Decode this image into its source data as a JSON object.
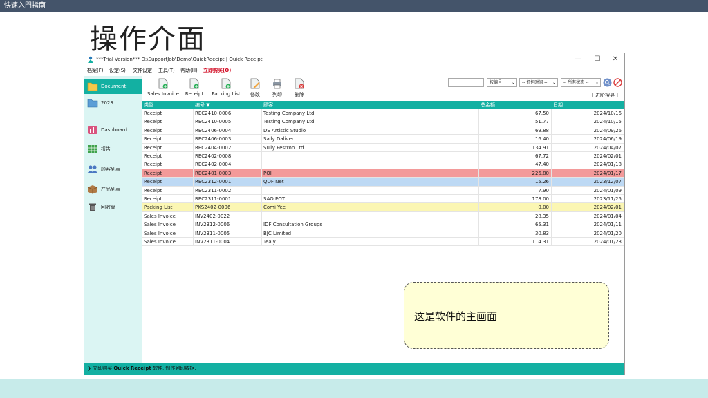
{
  "slide": {
    "header": "快速入門指南",
    "title": "操作介面"
  },
  "window": {
    "title": "***Trial Version*** D:\\SupportJob\\Demo\\QuickReceipt | Quick Receipt",
    "minimize": "—",
    "maximize": "☐",
    "close": "✕"
  },
  "menu": {
    "file": "档案(F)",
    "settings": "设定(S)",
    "doc_settings": "文件设定",
    "tools": "工具(T)",
    "help": "帮助(H)",
    "buy": "立即购买(O)"
  },
  "sidebar": {
    "items": [
      {
        "label": "Document"
      },
      {
        "label": "2023"
      },
      {
        "label": "Dashboard"
      },
      {
        "label": "报告"
      },
      {
        "label": "顾客列表"
      },
      {
        "label": "产品列表"
      },
      {
        "label": "回收筒"
      }
    ]
  },
  "toolbar": {
    "sales_invoice": "Sales Invoice",
    "receipt": "Receipt",
    "packing_list": "Packing List",
    "edit": "修改",
    "print": "列印",
    "delete": "删除",
    "filter_field": "按编号",
    "filter_time": "-- 任何时间 --",
    "filter_status": "-- 所有状态 --",
    "advanced": "[ 进阶搜寻 ]"
  },
  "table": {
    "headers": [
      "类型",
      "编号 ▼",
      "顾客",
      "总金额",
      "日期"
    ],
    "rows": [
      {
        "type": "Receipt",
        "no": "REC2410-0006",
        "customer": "Testing Company Ltd",
        "amount": "67.50",
        "date": "2024/10/16"
      },
      {
        "type": "Receipt",
        "no": "REC2410-0005",
        "customer": "Testing Company Ltd",
        "amount": "51.77",
        "date": "2024/10/15"
      },
      {
        "type": "Receipt",
        "no": "REC2406-0004",
        "customer": "DS Artistic Studio",
        "amount": "69.88",
        "date": "2024/09/26"
      },
      {
        "type": "Receipt",
        "no": "REC2406-0003",
        "customer": "Sally Daliver",
        "amount": "16.40",
        "date": "2024/06/19"
      },
      {
        "type": "Receipt",
        "no": "REC2404-0002",
        "customer": "Sully Pestron Ltd",
        "amount": "134.91",
        "date": "2024/04/07"
      },
      {
        "type": "Receipt",
        "no": "REC2402-0008",
        "customer": "",
        "amount": "67.72",
        "date": "2024/02/01"
      },
      {
        "type": "Receipt",
        "no": "REC2402-0004",
        "customer": "",
        "amount": "47.40",
        "date": "2024/01/18"
      },
      {
        "type": "Receipt",
        "no": "REC2401-0003",
        "customer": "POI",
        "amount": "226.80",
        "date": "2024/01/17"
      },
      {
        "type": "Receipt",
        "no": "REC2312-0001",
        "customer": "QDF Net",
        "amount": "15.26",
        "date": "2023/12/07"
      },
      {
        "type": "Receipt",
        "no": "REC2311-0002",
        "customer": "",
        "amount": "7.90",
        "date": "2024/01/09"
      },
      {
        "type": "Receipt",
        "no": "REC2311-0001",
        "customer": "SAO POT",
        "amount": "178.00",
        "date": "2023/11/25"
      },
      {
        "type": "Packing List",
        "no": "PKS2402-0006",
        "customer": "Comi Yee",
        "amount": "0.00",
        "date": "2024/02/01"
      },
      {
        "type": "Sales Invoice",
        "no": "INV2402-0022",
        "customer": "",
        "amount": "28.35",
        "date": "2024/01/04"
      },
      {
        "type": "Sales Invoice",
        "no": "INV2312-0006",
        "customer": "IDF Consultation Groups",
        "amount": "65.31",
        "date": "2024/01/11"
      },
      {
        "type": "Sales Invoice",
        "no": "INV2311-0005",
        "customer": "BJC Limited",
        "amount": "30.83",
        "date": "2024/01/20"
      },
      {
        "type": "Sales Invoice",
        "no": "INV2311-0004",
        "customer": "Tealy",
        "amount": "114.31",
        "date": "2024/01/23"
      }
    ]
  },
  "status": {
    "prefix": "立即购买",
    "brand": "Quick Receipt",
    "suffix": "软件, 制作列印收据."
  },
  "callout": "这是软件的主画面",
  "colors": {
    "accent": "#13b0a2",
    "sidebar_bg": "#dbf5f3",
    "highlight_red": "#f39a9a",
    "highlight_blue": "#bdd9f4",
    "highlight_yellow": "#fbf6b3"
  }
}
